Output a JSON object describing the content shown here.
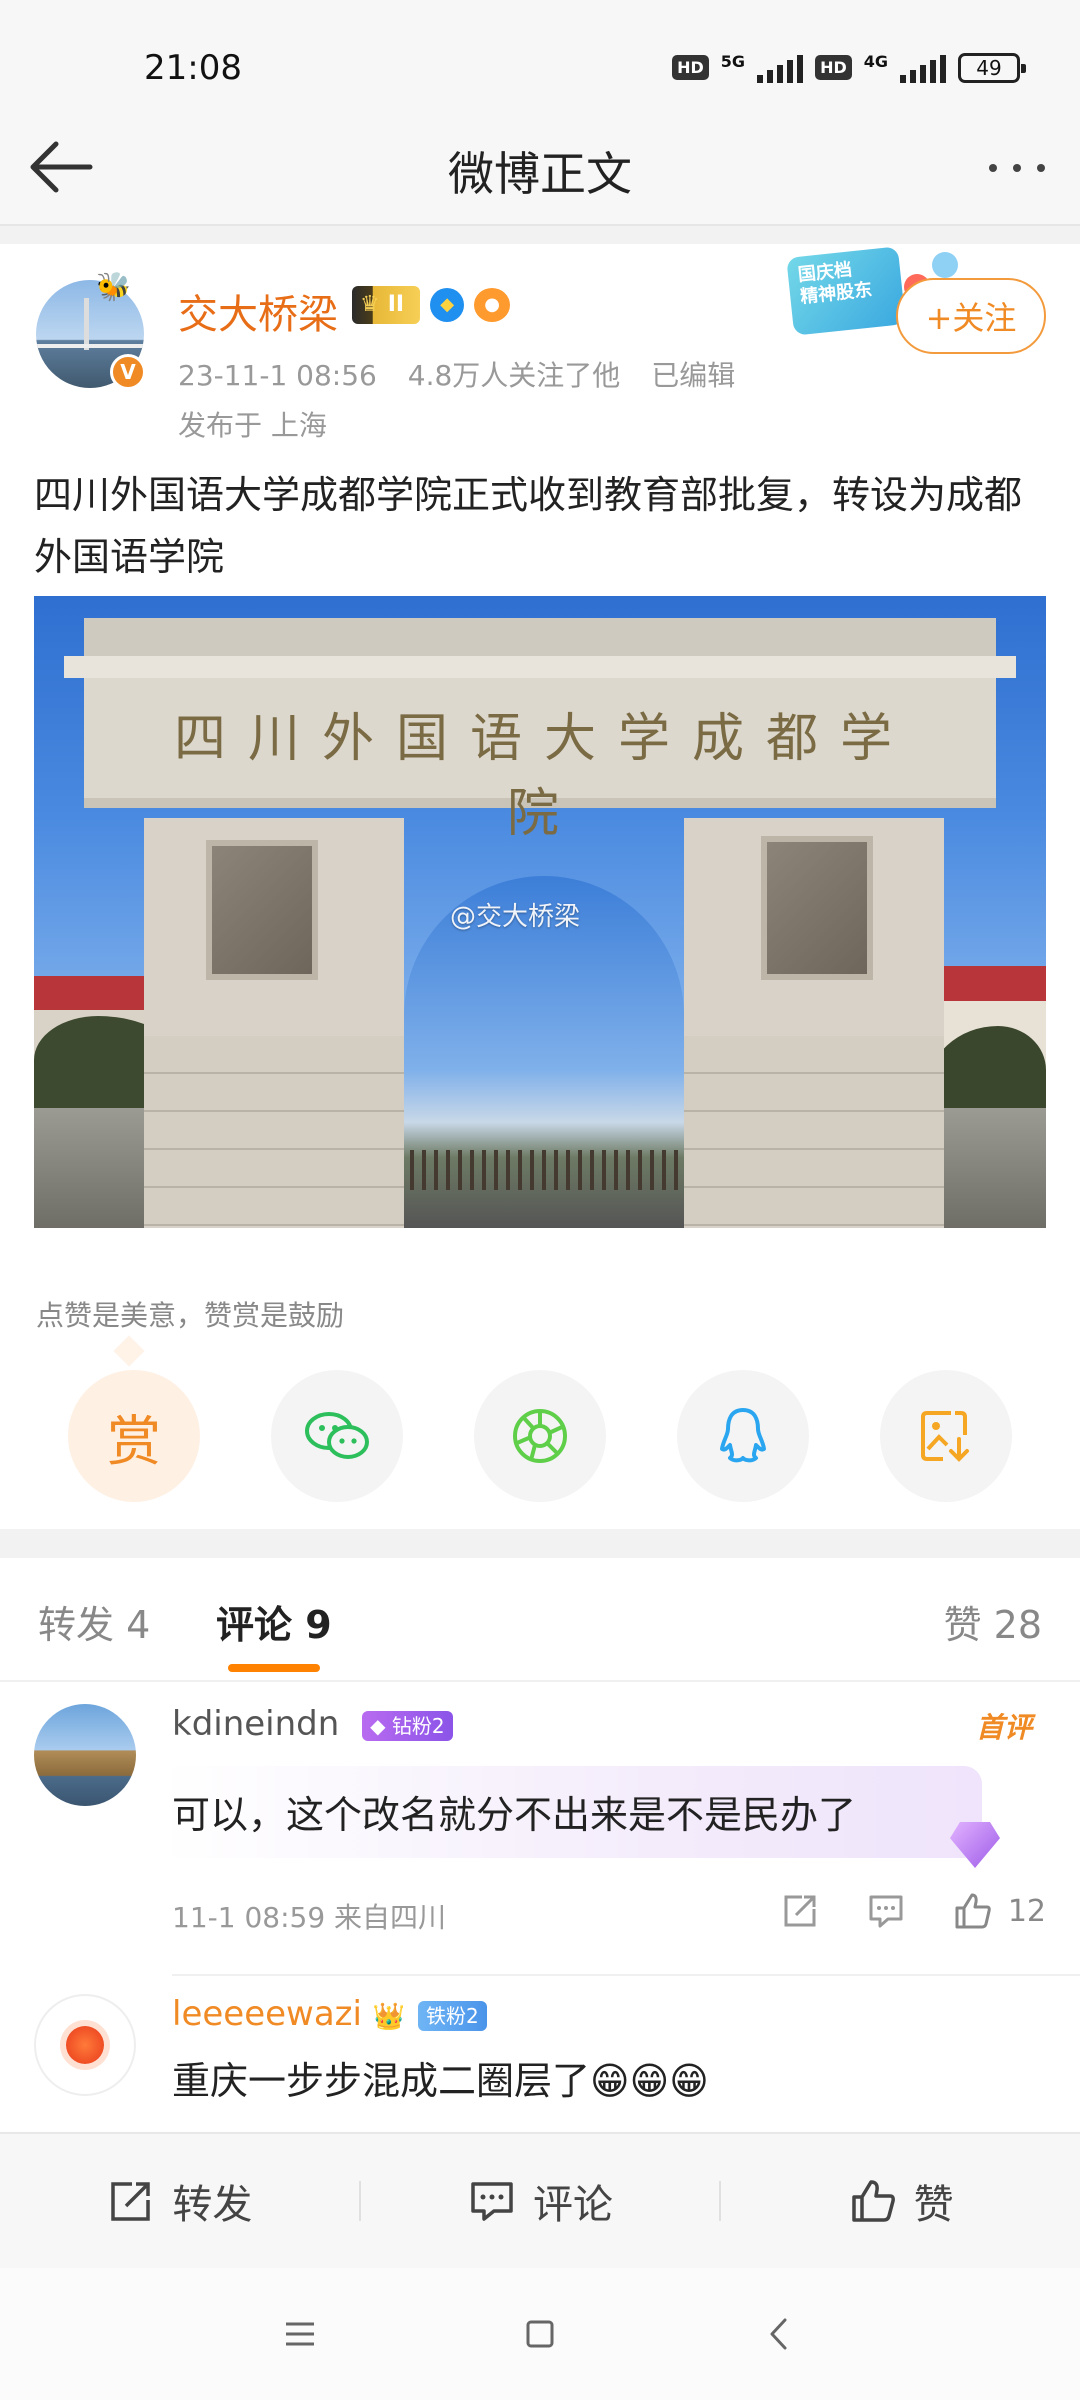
{
  "status_bar": {
    "time": "21:08",
    "network1": "5G",
    "network2": "4G",
    "hd1": "HD",
    "hd2": "HD",
    "battery": "49"
  },
  "nav": {
    "title": "微博正文"
  },
  "post": {
    "author": "交大桥梁",
    "level_badge": "II",
    "timestamp": "23-11-1 08:56",
    "followers": "4.8万人关注了他",
    "edited": "已编辑",
    "location": "发布于 上海",
    "follow_label": "+关注",
    "activity_sticker": "国庆档\n精神股东",
    "text": "四川外国语大学成都学院正式收到教育部批复，转设为成都外国语学院",
    "image": {
      "sign_text": "四川外国语大学成都学院",
      "watermark": "@交大桥梁"
    }
  },
  "reward": {
    "hint": "点赞是美意，赞赏是鼓励",
    "reward_label": "赏",
    "share_targets": [
      "赏",
      "wechat-icon",
      "moments-icon",
      "qq-icon",
      "save-image-icon"
    ]
  },
  "tabs": {
    "repost": "转发 4",
    "comment": "评论 9",
    "likes": "赞 28"
  },
  "comments": [
    {
      "user": "kdineindn",
      "badge": "钻粉2",
      "first_label": "首评",
      "text": "可以，这个改名就分不出来是不是民办了",
      "meta": "11-1 08:59 来自四川",
      "likes": "12"
    },
    {
      "user": "leeeeewazi",
      "badge": "铁粉2",
      "text": "重庆一步步混成二圈层了😁😁😁"
    }
  ],
  "bottom_bar": {
    "repost": "转发",
    "comment": "评论",
    "like": "赞"
  },
  "colors": {
    "brand_orange": "#ff8200",
    "name_orange": "#e86d17"
  }
}
